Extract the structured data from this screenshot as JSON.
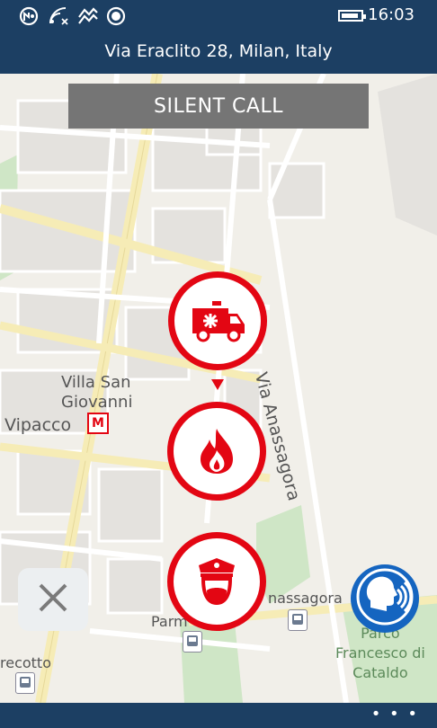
{
  "status_bar": {
    "time": "16:03",
    "icons": [
      "nfc-icon",
      "wifi-icon",
      "data-icon",
      "record-icon",
      "battery-icon"
    ]
  },
  "header": {
    "address": "Via Eraclito 28, Milan, Italy"
  },
  "silent_call": {
    "label": "SILENT CALL"
  },
  "map": {
    "labels": {
      "villa_line1": "Villa San",
      "villa_line2": "Giovanni",
      "vipacco": "Vipacco",
      "anassagora": "Via Anassagora",
      "anassagora_stop": "nassagora",
      "parma": "Parm",
      "parco_line1": "Parco",
      "parco_line2": "Francesco di",
      "parco_line3": "Cataldo",
      "recotto": "recotto",
      "metro": "M"
    }
  },
  "emergency_buttons": [
    {
      "name": "ambulance",
      "icon": "ambulance-icon"
    },
    {
      "name": "fire",
      "icon": "fire-icon"
    },
    {
      "name": "police",
      "icon": "police-icon"
    }
  ],
  "colors": {
    "header_bg": "#1c3f63",
    "emergency_red": "#e30613",
    "speak_blue": "#1565c0",
    "silent_gray": "#757575"
  },
  "app_bar": {
    "more": "• • •"
  }
}
